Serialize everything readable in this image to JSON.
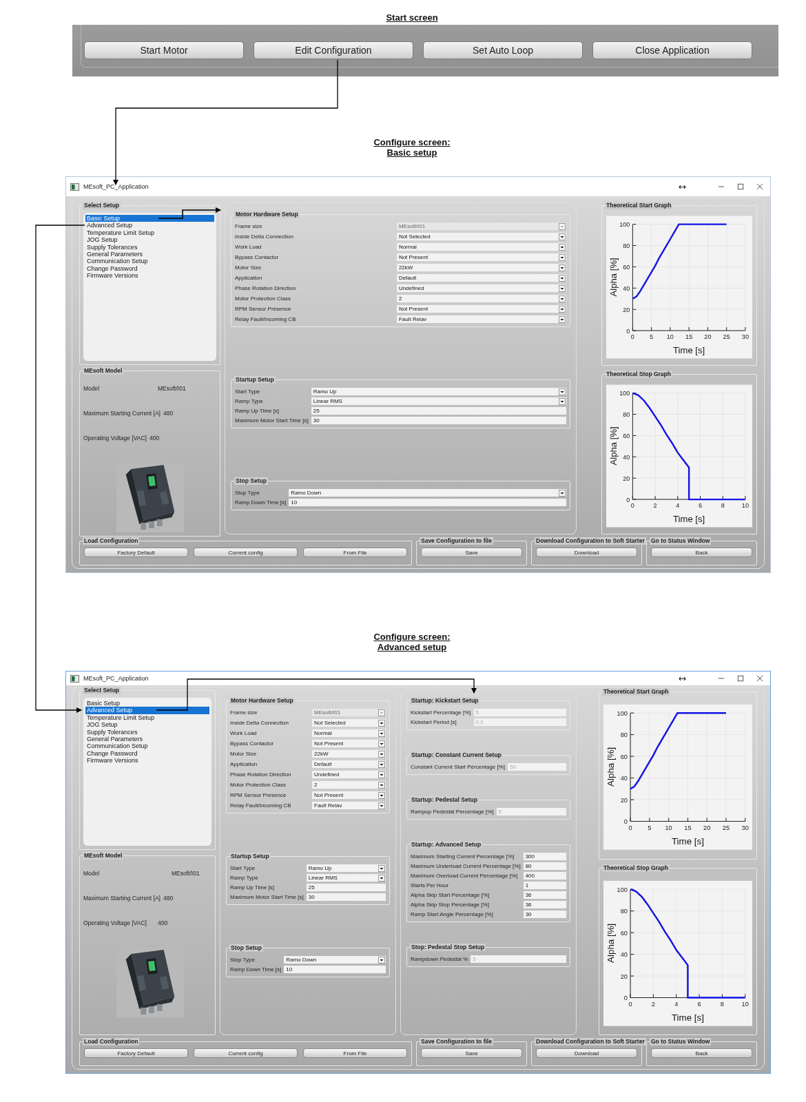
{
  "start_screen": {
    "caption": "Start screen",
    "buttons": [
      "Start Motor",
      "Edit Configuration",
      "Set Auto Loop",
      "Close Application"
    ]
  },
  "screens": [
    {
      "caption": [
        "Configure screen:",
        "Basic setup"
      ],
      "window": {
        "title": "MEsoft_PC_Application",
        "select_setup": {
          "title": "Select Setup",
          "items": [
            {
              "label": "Basic Setup",
              "selected": true
            },
            {
              "label": "Advanced Setup",
              "selected": false
            },
            {
              "label": "Temperature Limit Setup",
              "selected": false
            },
            {
              "label": "JOG Setup",
              "selected": false
            },
            {
              "label": "Supply Tolerances",
              "selected": false
            },
            {
              "label": "General Parameters",
              "selected": false
            },
            {
              "label": "Communication Setup",
              "selected": false
            },
            {
              "label": "Change Password",
              "selected": false
            },
            {
              "label": "Firmware Versions",
              "selected": false
            }
          ]
        },
        "model": {
          "title": "MEsoft Model",
          "rows": [
            {
              "label": "Model",
              "value": "MEsoft/I01"
            },
            {
              "label": "Maximum Starting Current [A]",
              "value": "480"
            },
            {
              "label": "Operating Voltage [VAC]",
              "value": "400"
            }
          ]
        },
        "panels": [
          {
            "groups": [
              {
                "title": "Motor Hardware Setup",
                "fields": [
                  {
                    "label": "Frame size",
                    "value": "MEsoft/I01",
                    "kind": "combo",
                    "disabled": true
                  },
                  {
                    "label": "Inside Delta Connection",
                    "value": "Not Selected",
                    "kind": "combo",
                    "disabled": false
                  },
                  {
                    "label": "Work Load",
                    "value": "Normal",
                    "kind": "combo",
                    "disabled": false
                  },
                  {
                    "label": "Bypass Contactor",
                    "value": "Not Present",
                    "kind": "combo",
                    "disabled": false
                  },
                  {
                    "label": "Motor Size",
                    "value": "22kW",
                    "kind": "combo",
                    "disabled": false
                  },
                  {
                    "label": "Application",
                    "value": "Default",
                    "kind": "combo",
                    "disabled": false
                  },
                  {
                    "label": "Phase Rotation Direction",
                    "value": "Undefined",
                    "kind": "combo",
                    "disabled": false
                  },
                  {
                    "label": "Motor Protection Class",
                    "value": "2",
                    "kind": "combo",
                    "disabled": false
                  },
                  {
                    "label": "RPM Sensor Presence",
                    "value": "Not Present",
                    "kind": "combo",
                    "disabled": false
                  },
                  {
                    "label": "Relay Fault/Incoming CB",
                    "value": "Fault Relav",
                    "kind": "combo",
                    "disabled": false
                  }
                ]
              },
              {
                "title": "Startup Setup",
                "fields": [
                  {
                    "label": "Start Type",
                    "value": "Ramo Up",
                    "kind": "combo",
                    "disabled": false
                  },
                  {
                    "label": "Ramp Type",
                    "value": "Linear RMS",
                    "kind": "combo",
                    "disabled": false
                  },
                  {
                    "label": "Ramp Up Time [s]",
                    "value": "25",
                    "kind": "text",
                    "disabled": false
                  },
                  {
                    "label": "Maximum Motor Start Time [s]",
                    "value": "30",
                    "kind": "text",
                    "disabled": false
                  }
                ]
              },
              {
                "title": "Stop Setup",
                "fields": [
                  {
                    "label": "Stop Type",
                    "value": "Ramo Down",
                    "kind": "combo",
                    "disabled": false
                  },
                  {
                    "label": "Ramp Down Time [s]",
                    "value": "10",
                    "kind": "text",
                    "disabled": false
                  }
                ]
              }
            ]
          }
        ],
        "graphs": [
          {
            "chart_data": {
              "type": "line",
              "title": "Theoretical Start Graph",
              "xlabel": "Time [s]",
              "ylabel": "Alpha [%]",
              "x": [
                0,
                1,
                2,
                3,
                4,
                5,
                6,
                7,
                8,
                9,
                10,
                11,
                12.3,
                25
              ],
              "series": [
                {
                  "color": "#1414e6",
                  "values": [
                    30,
                    32,
                    37,
                    43,
                    49,
                    55,
                    61,
                    68,
                    74,
                    80,
                    86,
                    92,
                    100,
                    100
                  ]
                }
              ],
              "xlim": [
                0,
                30
              ],
              "ylim": [
                0,
                100
              ],
              "grid": true,
              "xticks": [
                0,
                5,
                10,
                15,
                20,
                25,
                30
              ],
              "yticks": [
                0,
                20,
                40,
                60,
                80,
                100
              ]
            }
          },
          {
            "chart_data": {
              "type": "line",
              "title": "Theoretical Stop Graph",
              "xlabel": "Time [s]",
              "ylabel": "Alpha [%]",
              "x": [
                0,
                0.5,
                1,
                1.5,
                2,
                2.5,
                3,
                3.5,
                4,
                4.5,
                5,
                5,
                10
              ],
              "series": [
                {
                  "color": "#1414e6",
                  "values": [
                    100,
                    98,
                    93,
                    86,
                    78,
                    70,
                    61,
                    53,
                    44,
                    37,
                    30,
                    0,
                    0
                  ]
                }
              ],
              "xlim": [
                0,
                10
              ],
              "ylim": [
                0,
                100
              ],
              "grid": true,
              "xticks": [
                0,
                2,
                4,
                6,
                8,
                10
              ],
              "yticks": [
                0,
                20,
                40,
                60,
                80,
                100
              ]
            }
          }
        ],
        "bottom_groups": [
          {
            "title": "Load Configuration",
            "buttons": [
              "Factory Default",
              "Current config",
              "From File"
            ]
          },
          {
            "title": "Save Configuration to file",
            "buttons": [
              "Save"
            ]
          },
          {
            "title": "Download Configuration to Soft Starter",
            "buttons": [
              "Download"
            ]
          },
          {
            "title": "Go to Status Window",
            "buttons": [
              "Back"
            ]
          }
        ]
      }
    },
    {
      "caption": [
        "Configure screen:",
        "Advanced setup"
      ],
      "window": {
        "title": "MEsoft_PC_Application",
        "select_setup": {
          "title": "Select Setup",
          "items": [
            {
              "label": "Basic Setup",
              "selected": false
            },
            {
              "label": "Advanced Setup",
              "selected": true
            },
            {
              "label": "Temperature Limit Setup",
              "selected": false
            },
            {
              "label": "JOG Setup",
              "selected": false
            },
            {
              "label": "Supply Tolerances",
              "selected": false
            },
            {
              "label": "General Parameters",
              "selected": false
            },
            {
              "label": "Communication Setup",
              "selected": false
            },
            {
              "label": "Change Password",
              "selected": false
            },
            {
              "label": "Firmware Versions",
              "selected": false
            }
          ]
        },
        "model": {
          "title": "MEsoft Model",
          "rows": [
            {
              "label": "Model",
              "value": "MEsoft/I01"
            },
            {
              "label": "Maximum Starting Current [A]",
              "value": "480"
            },
            {
              "label": "Operating Voltage [VAC]",
              "value": "400"
            }
          ]
        },
        "panels": [
          {
            "groups": [
              {
                "title": "Motor Hardware Setup",
                "fields": [
                  {
                    "label": "Frame size",
                    "value": "MEsoft/I01",
                    "kind": "combo",
                    "disabled": true
                  },
                  {
                    "label": "Inside Delta Connection",
                    "value": "Not Selected",
                    "kind": "combo",
                    "disabled": false
                  },
                  {
                    "label": "Work Load",
                    "value": "Normal",
                    "kind": "combo",
                    "disabled": false
                  },
                  {
                    "label": "Bypass Contactor",
                    "value": "Not Present",
                    "kind": "combo",
                    "disabled": false
                  },
                  {
                    "label": "Motor Size",
                    "value": "22kW",
                    "kind": "combo",
                    "disabled": false
                  },
                  {
                    "label": "Application",
                    "value": "Default",
                    "kind": "combo",
                    "disabled": false
                  },
                  {
                    "label": "Phase Rotation Direction",
                    "value": "Undefined",
                    "kind": "combo",
                    "disabled": false
                  },
                  {
                    "label": "Motor Protection Class",
                    "value": "2",
                    "kind": "combo",
                    "disabled": false
                  },
                  {
                    "label": "RPM Sensor Presence",
                    "value": "Not Present",
                    "kind": "combo",
                    "disabled": false
                  },
                  {
                    "label": "Relay Fault/Incoming CB",
                    "value": "Fault Relav",
                    "kind": "combo",
                    "disabled": false
                  }
                ]
              },
              {
                "title": "Startup Setup",
                "fields": [
                  {
                    "label": "Start Type",
                    "value": "Ramo Up",
                    "kind": "combo",
                    "disabled": false
                  },
                  {
                    "label": "Ramp Type",
                    "value": "Linear RMS",
                    "kind": "combo",
                    "disabled": false
                  },
                  {
                    "label": "Ramp Up Time [s]",
                    "value": "25",
                    "kind": "text",
                    "disabled": false
                  },
                  {
                    "label": "Maximum Motor Start Time [s]",
                    "value": "30",
                    "kind": "text",
                    "disabled": false
                  }
                ]
              },
              {
                "title": "Stop Setup",
                "fields": [
                  {
                    "label": "Stop Type",
                    "value": "Ramo Down",
                    "kind": "combo",
                    "disabled": false
                  },
                  {
                    "label": "Ramp Down Time [s]",
                    "value": "10",
                    "kind": "text",
                    "disabled": false
                  }
                ]
              }
            ]
          },
          {
            "groups": [
              {
                "title": "Startup: Kickstart Setup",
                "fields": [
                  {
                    "label": "Kickstart Percentage [%]",
                    "value": "5",
                    "kind": "text",
                    "disabled": true
                  },
                  {
                    "label": "Kickstart Period [s]",
                    "value": "0.2",
                    "kind": "text",
                    "disabled": true
                  }
                ]
              },
              {
                "title": "Startup: Constant Current Setup",
                "fields": [
                  {
                    "label": "Constant Current Start Percentage [%]",
                    "value": "50",
                    "kind": "text",
                    "disabled": true
                  }
                ]
              },
              {
                "title": "Startup: Pedestal Setup",
                "fields": [
                  {
                    "label": "Rampup Pedestal Percentage [%]",
                    "value": "5",
                    "kind": "text",
                    "disabled": true
                  }
                ]
              },
              {
                "title": "Startup: Advanced Setup",
                "fields": [
                  {
                    "label": "Maximum Starting Current Percentage [%]",
                    "value": "300",
                    "kind": "text",
                    "disabled": false
                  },
                  {
                    "label": "Maximum Underload Current Percentage [%]",
                    "value": "80",
                    "kind": "text",
                    "disabled": false
                  },
                  {
                    "label": "Maximum Overload Current Percentage [%]",
                    "value": "400",
                    "kind": "text",
                    "disabled": false
                  },
                  {
                    "label": "Starts Per Hour",
                    "value": "1",
                    "kind": "text",
                    "disabled": false
                  },
                  {
                    "label": "Alpha Skip Start Percentage [%]",
                    "value": "36",
                    "kind": "text",
                    "disabled": false
                  },
                  {
                    "label": "Alpha Skip Stop Percentage [%]",
                    "value": "36",
                    "kind": "text",
                    "disabled": false
                  },
                  {
                    "label": "Ramp Start Angle Percentage [%]",
                    "value": "30",
                    "kind": "text",
                    "disabled": false
                  }
                ]
              },
              {
                "title": "Stop: Pedestal Stop Setup",
                "fields": [
                  {
                    "label": "Rampdown Pedestal %",
                    "value": "5",
                    "kind": "text",
                    "disabled": true
                  }
                ]
              }
            ]
          }
        ],
        "graphs": [
          {
            "chart_data": {
              "type": "line",
              "title": "Theoretical Start Graph",
              "xlabel": "Time [s]",
              "ylabel": "Alpha [%]",
              "x": [
                0,
                1,
                2,
                3,
                4,
                5,
                6,
                7,
                8,
                9,
                10,
                11,
                12.3,
                25
              ],
              "series": [
                {
                  "color": "#1414e6",
                  "values": [
                    30,
                    32,
                    37,
                    43,
                    49,
                    55,
                    61,
                    68,
                    74,
                    80,
                    86,
                    92,
                    100,
                    100
                  ]
                }
              ],
              "xlim": [
                0,
                30
              ],
              "ylim": [
                0,
                100
              ],
              "grid": true,
              "xticks": [
                0,
                5,
                10,
                15,
                20,
                25,
                30
              ],
              "yticks": [
                0,
                20,
                40,
                60,
                80,
                100
              ]
            }
          },
          {
            "chart_data": {
              "type": "line",
              "title": "Theoretical Stop Graph",
              "xlabel": "Time [s]",
              "ylabel": "Alpha [%]",
              "x": [
                0,
                0.5,
                1,
                1.5,
                2,
                2.5,
                3,
                3.5,
                4,
                4.5,
                5,
                5,
                10
              ],
              "series": [
                {
                  "color": "#1414e6",
                  "values": [
                    100,
                    98,
                    93,
                    86,
                    78,
                    70,
                    61,
                    53,
                    44,
                    37,
                    30,
                    0,
                    0
                  ]
                }
              ],
              "xlim": [
                0,
                10
              ],
              "ylim": [
                0,
                100
              ],
              "grid": true,
              "xticks": [
                0,
                2,
                4,
                6,
                8,
                10
              ],
              "yticks": [
                0,
                20,
                40,
                60,
                80,
                100
              ]
            }
          }
        ],
        "bottom_groups": [
          {
            "title": "Load Configuration",
            "buttons": [
              "Factory Default",
              "Current config",
              "From File"
            ]
          },
          {
            "title": "Save Configuration to file",
            "buttons": [
              "Save"
            ]
          },
          {
            "title": "Download Configuration to Soft Starter",
            "buttons": [
              "Download"
            ]
          },
          {
            "title": "Go to Status Window",
            "buttons": [
              "Back"
            ]
          }
        ]
      }
    }
  ]
}
